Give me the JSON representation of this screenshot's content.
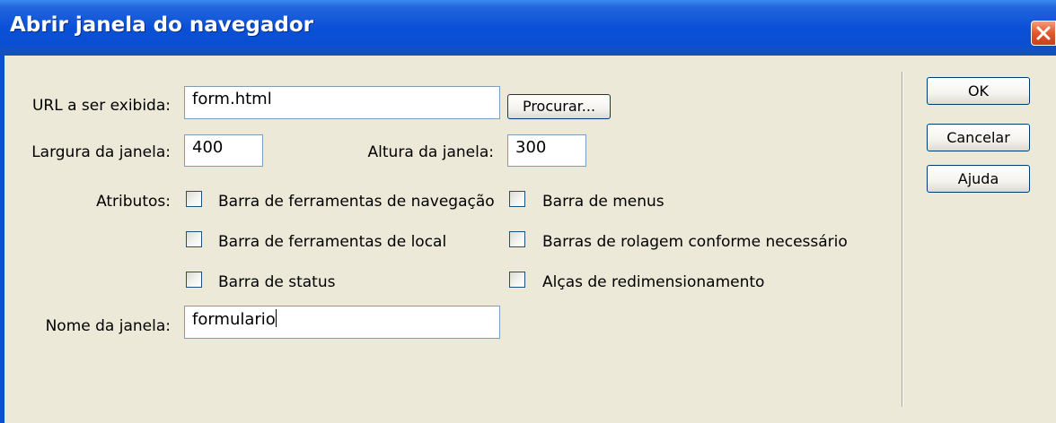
{
  "window": {
    "title": "Abrir janela do navegador"
  },
  "form": {
    "url_label": "URL a ser exibida:",
    "url_value": "form.html",
    "browse_label": "Procurar...",
    "width_label": "Largura da janela:",
    "width_value": "400",
    "height_label": "Altura da janela:",
    "height_value": "300",
    "attributes_label": "Atributos:",
    "attributes": [
      {
        "label": "Barra de ferramentas de navegação",
        "checked": false
      },
      {
        "label": "Barra de menus",
        "checked": false
      },
      {
        "label": "Barra de ferramentas de local",
        "checked": false
      },
      {
        "label": "Barras de rolagem conforme necessário",
        "checked": false
      },
      {
        "label": "Barra de status",
        "checked": false
      },
      {
        "label": "Alças de redimensionamento",
        "checked": false
      }
    ],
    "name_label": "Nome da janela:",
    "name_value": "formulario"
  },
  "buttons": {
    "ok": "OK",
    "cancel": "Cancelar",
    "help": "Ajuda"
  },
  "colors": {
    "titlebar": "#0a50d8",
    "close": "#e2582c",
    "dialog_bg": "#ece9d8"
  }
}
